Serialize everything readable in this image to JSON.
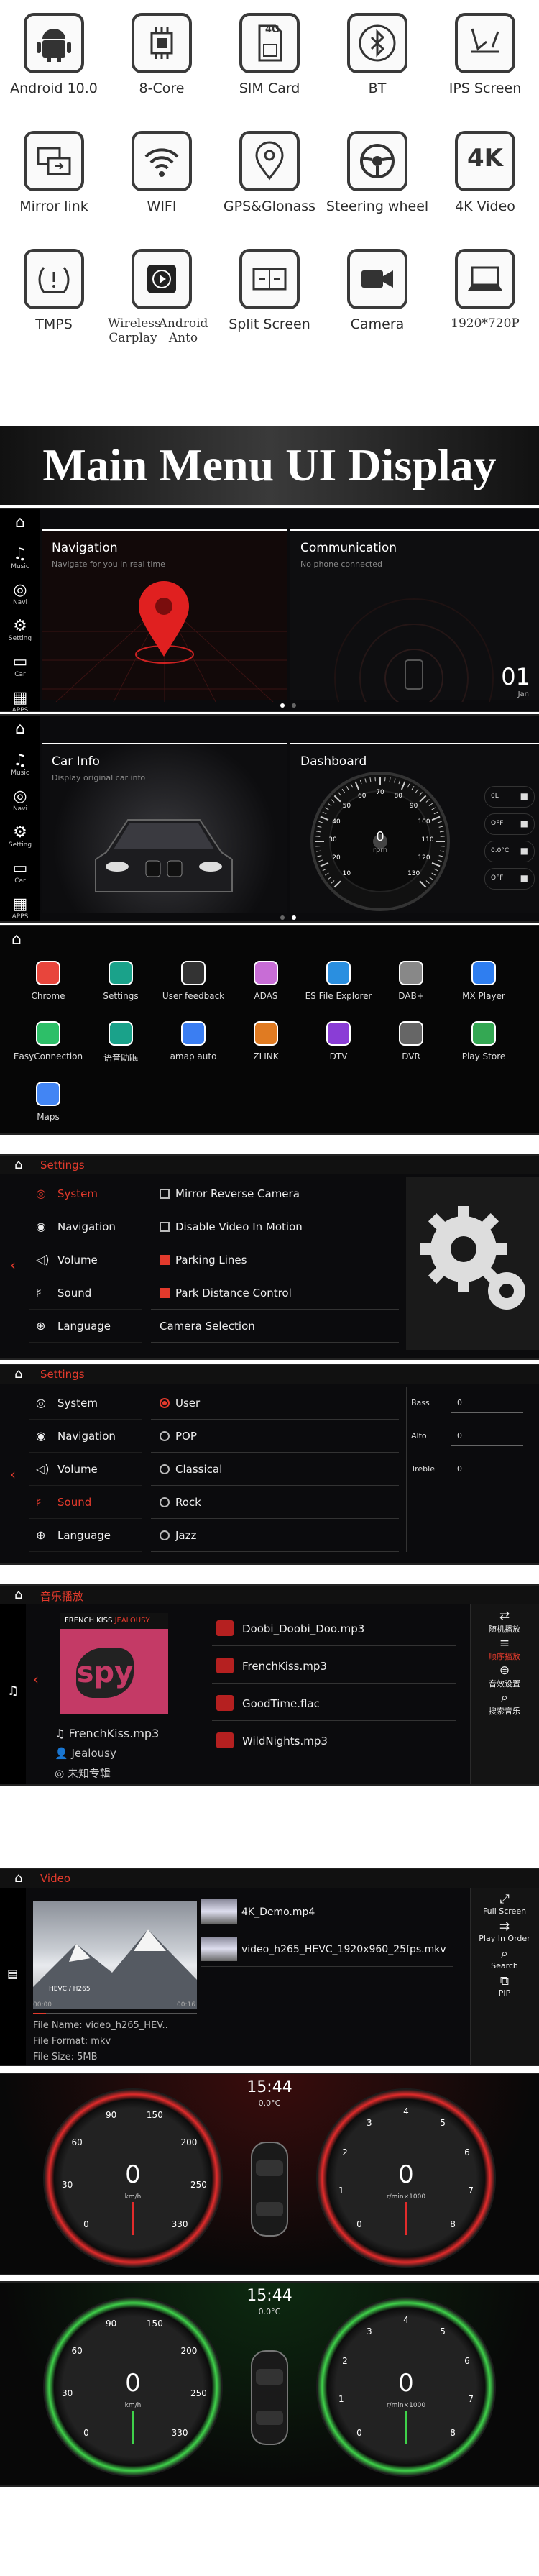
{
  "features": [
    {
      "label": "Android 10.0",
      "icon": "android-icon"
    },
    {
      "label": "8-Core",
      "icon": "chip-icon"
    },
    {
      "label": "SIM Card",
      "icon": "sim-card-icon"
    },
    {
      "label": "BT",
      "icon": "bluetooth-icon"
    },
    {
      "label": "IPS Screen",
      "icon": "ips-screen-icon"
    },
    {
      "label": "Mirror link",
      "icon": "mirror-link-icon"
    },
    {
      "label": "WIFI",
      "icon": "wifi-icon"
    },
    {
      "label": "GPS&Glonass",
      "icon": "gps-pin-icon"
    },
    {
      "label": "Steering wheel",
      "icon": "steering-wheel-icon"
    },
    {
      "label": "4K Video",
      "icon": "4k-icon"
    },
    {
      "label": "TMPS",
      "icon": "tire-pressure-icon"
    },
    {
      "label": "Wireless Carplay",
      "icon": "carplay-icon"
    },
    {
      "label": "Android Anto",
      "icon": "android-auto-icon"
    },
    {
      "label": "Split Screen",
      "icon": "split-screen-icon"
    },
    {
      "label": "Camera",
      "icon": "camera-icon"
    },
    {
      "label": "1920*720P",
      "icon": "laptop-icon"
    }
  ],
  "icon_texts": {
    "sim": "4G",
    "k4": "4K"
  },
  "banner": {
    "title": "Main Menu UI Display"
  },
  "sidebar": {
    "music": "Music",
    "nav": "Navi",
    "setting": "Setting",
    "car": "Car",
    "apps": "APPS"
  },
  "home1": {
    "nav_title": "Navigation",
    "nav_sub": "Navigate for you in real time",
    "comm_title": "Communication",
    "comm_sub": "No phone connected",
    "day": "01",
    "month": "Jan"
  },
  "home2": {
    "car_title": "Car Info",
    "car_sub": "Display original car info",
    "dash_title": "Dashboard",
    "rpm_value": "0",
    "rpm_unit": "rpm",
    "speed_ticks": [
      "10",
      "20",
      "30",
      "40",
      "50",
      "60",
      "70",
      "80",
      "90",
      "100",
      "110",
      "120",
      "130"
    ],
    "indicators": [
      "0L",
      "OFF",
      "0.0°C",
      "OFF"
    ]
  },
  "apps": [
    {
      "label": "Chrome",
      "color": "#e8453c"
    },
    {
      "label": "Settings",
      "color": "#1aa28a"
    },
    {
      "label": "User feedback",
      "color": "#333333"
    },
    {
      "label": "ADAS",
      "color": "#c86dd6"
    },
    {
      "label": "ES File Explorer",
      "color": "#2a8fe0"
    },
    {
      "label": "DAB+",
      "color": "#888888"
    },
    {
      "label": "MX Player",
      "color": "#2f7ef0"
    },
    {
      "label": "EasyConnection",
      "color": "#2dbf68"
    },
    {
      "label": "语音助眠",
      "color": "#1aa28a"
    },
    {
      "label": "amap auto",
      "color": "#3b7ef2"
    },
    {
      "label": "ZLINK",
      "color": "#e07b22"
    },
    {
      "label": "DTV",
      "color": "#8a3dd6"
    },
    {
      "label": "DVR",
      "color": "#666666"
    },
    {
      "label": "Play Store",
      "color": "#34a853"
    },
    {
      "label": "Maps",
      "color": "#4285f4"
    }
  ],
  "settings1": {
    "header": "Settings",
    "menu": [
      "System",
      "Navigation",
      "Volume",
      "Sound",
      "Language"
    ],
    "options": [
      {
        "label": "Mirror Reverse Camera",
        "checked": false
      },
      {
        "label": "Disable Video In Motion",
        "checked": false
      },
      {
        "label": "Parking Lines",
        "checked": true
      },
      {
        "label": "Park Distance Control",
        "checked": true
      },
      {
        "label": "Camera Selection",
        "checked": null
      }
    ]
  },
  "settings2": {
    "header": "Settings",
    "menu": [
      "System",
      "Navigation",
      "Volume",
      "Sound",
      "Language"
    ],
    "presets": [
      "User",
      "POP",
      "Classical",
      "Rock",
      "Jazz"
    ],
    "eq": [
      {
        "label": "Bass",
        "value": "0"
      },
      {
        "label": "Alto",
        "value": "0"
      },
      {
        "label": "Treble",
        "value": "0"
      }
    ]
  },
  "music": {
    "header": "音乐播放",
    "album_top": "FRENCH KISS",
    "album_brand": "JEALOUSY",
    "album_logo": "spy",
    "tracks": [
      "Doobi_Doobi_Doo.mp3",
      "FrenchKiss.mp3",
      "GoodTime.flac",
      "WildNights.mp3"
    ],
    "now_title": "FrenchKiss.mp3",
    "artist": "Jealousy",
    "album": "未知专辑",
    "controls": [
      "随机播放",
      "顺序播放",
      "音效设置",
      "搜索音乐"
    ]
  },
  "video": {
    "header": "Video",
    "files": [
      "4K_Demo.mp4",
      "video_h265_HEVC_1920x960_25fps.mkv"
    ],
    "thumb_caption": "HEVC / H265",
    "time_start": "00:00",
    "time_end": "00:16",
    "file_name": "File Name: video_h265_HEV..",
    "file_format": "File Format: mkv",
    "file_size": "File Size: 5MB",
    "controls": [
      "Full Screen",
      "Play In Order",
      "Search",
      "PIP"
    ]
  },
  "cluster_red": {
    "time": "15:44",
    "temp": "0.0°C",
    "speed": "0",
    "speed_unit": "km/h",
    "rpm": "0",
    "rpm_unit": "r/min×1000",
    "speed_ticks": [
      "0",
      "30",
      "60",
      "90",
      "150",
      "200",
      "250",
      "330"
    ],
    "rpm_ticks": [
      "0",
      "1",
      "2",
      "3",
      "4",
      "5",
      "6",
      "7",
      "8"
    ],
    "accent": "#e22b2b"
  },
  "cluster_green": {
    "time": "15:44",
    "temp": "0.0°C",
    "speed": "0",
    "speed_unit": "km/h",
    "rpm": "0",
    "rpm_unit": "r/min×1000",
    "speed_ticks": [
      "0",
      "30",
      "60",
      "90",
      "150",
      "200",
      "250",
      "330"
    ],
    "rpm_ticks": [
      "0",
      "1",
      "2",
      "3",
      "4",
      "5",
      "6",
      "7",
      "8"
    ],
    "accent": "#3fd14a"
  }
}
